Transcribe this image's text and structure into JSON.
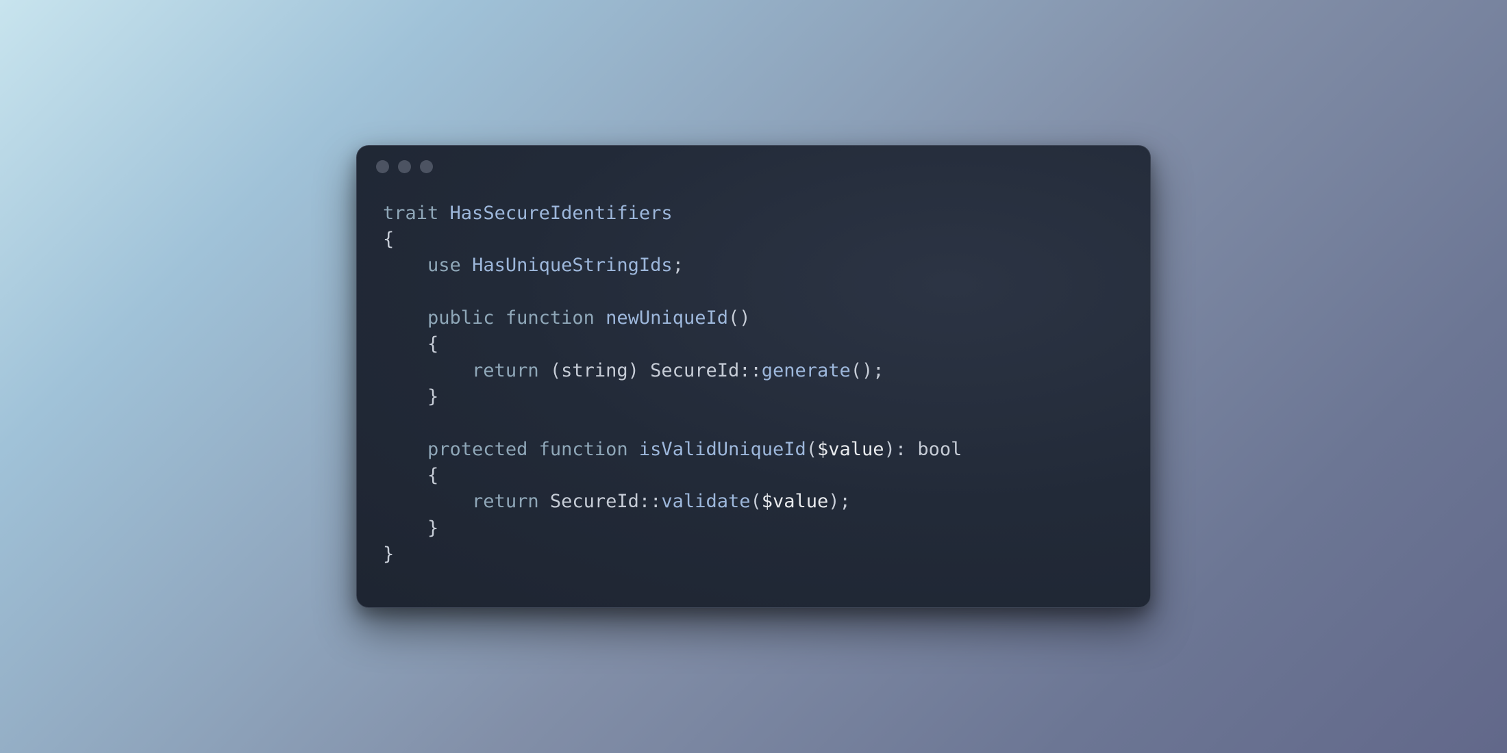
{
  "colors": {
    "keyword": "#8fa7b8",
    "identifier": "#9db7db",
    "variable": "#e8eaed",
    "punctuation": "#c6ccd6",
    "window_bg_start": "#2c3444",
    "window_bg_end": "#1c222e"
  },
  "code": {
    "l1_kw": "trait",
    "l1_name": "HasSecureIdentifiers",
    "l2": "{",
    "l3_kw": "use",
    "l3_name": "HasUniqueStringIds",
    "l3_end": ";",
    "l5_kw1": "public",
    "l5_kw2": "function",
    "l5_name": "newUniqueId",
    "l5_parens": "()",
    "l6": "{",
    "l7_kw": "return",
    "l7_cast": "(string)",
    "l7_class": "SecureId",
    "l7_scope": "::",
    "l7_fn": "generate",
    "l7_call": "();",
    "l8": "}",
    "l10_kw1": "protected",
    "l10_kw2": "function",
    "l10_name": "isValidUniqueId",
    "l10_open": "(",
    "l10_var": "$value",
    "l10_close_colon": "): ",
    "l10_ret": "bool",
    "l11": "{",
    "l12_kw": "return",
    "l12_class": "SecureId",
    "l12_scope": "::",
    "l12_fn": "validate",
    "l12_open": "(",
    "l12_var": "$value",
    "l12_close": ");",
    "l13": "}",
    "l14": "}"
  }
}
